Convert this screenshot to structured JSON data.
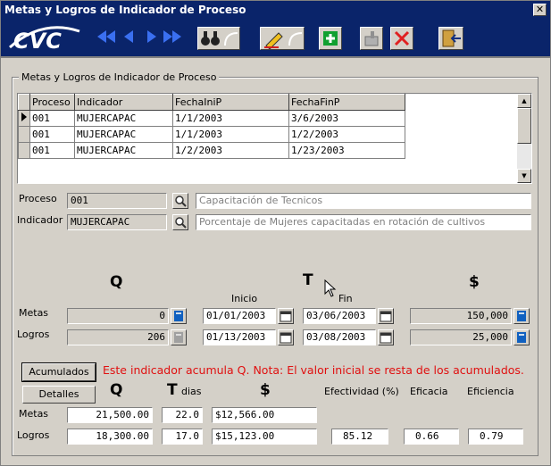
{
  "window": {
    "title": "Metas y Logros de Indicador de Proceso",
    "close": "✕"
  },
  "logo_text": "CVC",
  "group_title": "Metas y Logros de Indicador de Proceso",
  "grid": {
    "headers": [
      "Proceso",
      "Indicador",
      "FechaIniP",
      "FechaFinP"
    ],
    "rows": [
      [
        "001",
        "MUJERCAPAC",
        "1/1/2003",
        "3/6/2003"
      ],
      [
        "001",
        "MUJERCAPAC",
        "1/1/2003",
        "1/2/2003"
      ],
      [
        "001",
        "MUJERCAPAC",
        "1/2/2003",
        "1/23/2003"
      ]
    ]
  },
  "proceso": {
    "label": "Proceso",
    "code": "001",
    "desc": "Capacitación de Tecnicos"
  },
  "indicador": {
    "label": "Indicador",
    "code": "MUJERCAPAC",
    "desc": "Porcentaje de Mujeres capacitadas en rotación de cultivos"
  },
  "top": {
    "q_header": "Q",
    "t_header": "T",
    "money_header": "$",
    "inicio": "Inicio",
    "fin": "Fin",
    "metas_label": "Metas",
    "logros_label": "Logros",
    "metas": {
      "q": "0",
      "inicio": "01/01/2003",
      "fin": "03/06/2003",
      "money": "150,000"
    },
    "logros": {
      "q": "206",
      "inicio": "01/13/2003",
      "fin": "03/08/2003",
      "money": "25,000"
    }
  },
  "buttons": {
    "acumulados": "Acumulados",
    "detalles": "Detalles"
  },
  "note": "Este indicador acumula Q. Nota: El valor inicial se resta de los acumulados.",
  "bottom": {
    "q_header": "Q",
    "t_header": "T",
    "dias": "dias",
    "money_header": "$",
    "efectividad": "Efectividad (%)",
    "eficacia": "Eficacia",
    "eficiencia": "Eficiencia",
    "metas_label": "Metas",
    "logros_label": "Logros",
    "metas": {
      "q": "21,500.00",
      "t": "22.0",
      "money": "$12,566.00"
    },
    "logros": {
      "q": "18,300.00",
      "t": "17.0",
      "money": "$15,123.00",
      "efectividad": "85.12",
      "eficacia": "0.66",
      "eficiencia": "0.79"
    }
  }
}
